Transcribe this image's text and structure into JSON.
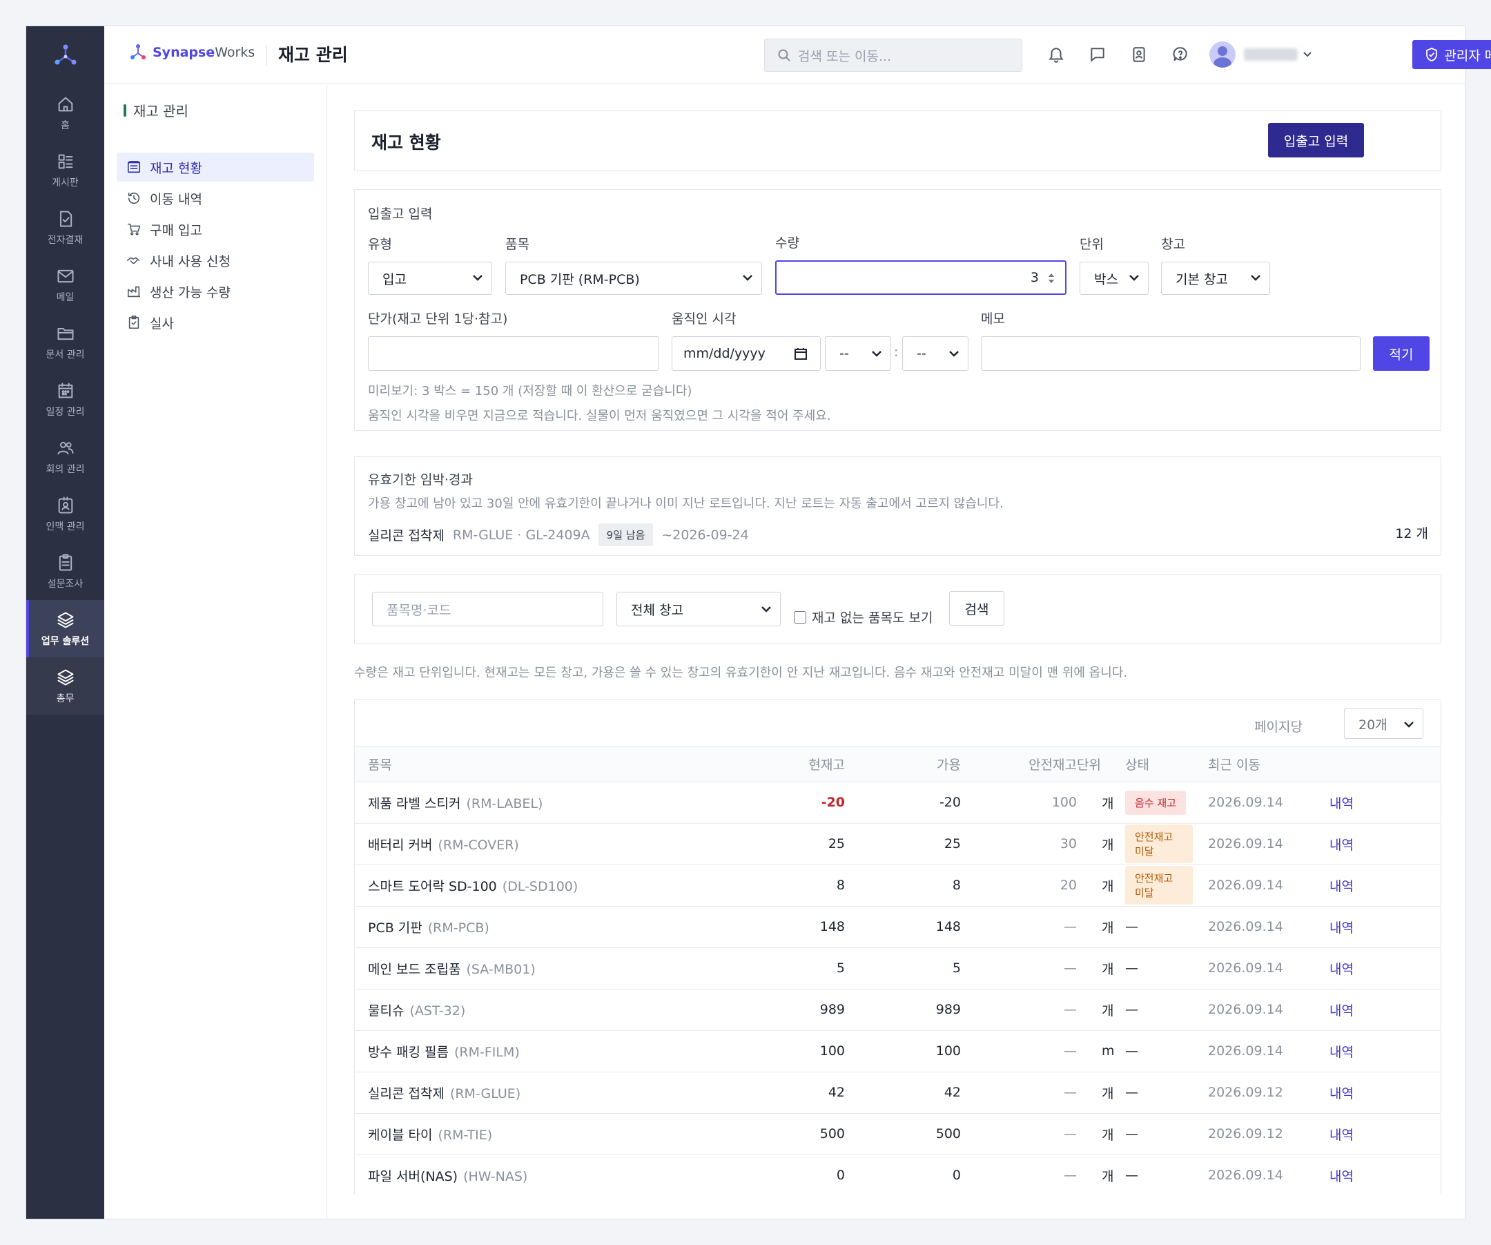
{
  "app": {
    "brand_bold": "Synapse",
    "brand_rest": "Works",
    "page_title": "재고 관리",
    "search_placeholder": "검색 또는 이동...",
    "admin_menu": "관리자 메뉴"
  },
  "rail": [
    {
      "label": "홈",
      "icon": "home-icon"
    },
    {
      "label": "게시판",
      "icon": "board-icon"
    },
    {
      "label": "전자결재",
      "icon": "approval-icon"
    },
    {
      "label": "메일",
      "icon": "mail-icon"
    },
    {
      "label": "문서 관리",
      "icon": "folder-icon"
    },
    {
      "label": "일정 관리",
      "icon": "calendar-icon"
    },
    {
      "label": "회의 관리",
      "icon": "people-icon"
    },
    {
      "label": "인맥 관리",
      "icon": "contact-icon"
    },
    {
      "label": "설문조사",
      "icon": "clipboard-icon"
    },
    {
      "label": "업무 솔루션",
      "icon": "layers-icon"
    },
    {
      "label": "총무",
      "icon": "layers-icon"
    }
  ],
  "subnav": {
    "title": "재고 관리",
    "items": [
      {
        "label": "재고 현황",
        "icon": "inventory-icon"
      },
      {
        "label": "이동 내역",
        "icon": "history-icon"
      },
      {
        "label": "구매 입고",
        "icon": "cart-icon"
      },
      {
        "label": "사내 사용 신청",
        "icon": "handshake-icon"
      },
      {
        "label": "생산 가능 수량",
        "icon": "factory-icon"
      },
      {
        "label": "실사",
        "icon": "checklist-icon"
      }
    ]
  },
  "main": {
    "title": "재고 현황",
    "entry_button": "입출고 입력"
  },
  "entry_form": {
    "title": "입출고 입력",
    "type_label": "유형",
    "type_value": "입고",
    "item_label": "품목",
    "item_value": "PCB 기판 (RM-PCB)",
    "qty_label": "수량",
    "qty_value": "3",
    "unit_label": "단위",
    "unit_value": "박스",
    "warehouse_label": "창고",
    "warehouse_value": "기본 창고",
    "price_label": "단가(재고 단위 1당·참고)",
    "time_label": "움직인 시각",
    "date_placeholder": "mm/dd/yyyy",
    "hour_value": "--",
    "minute_value": "--",
    "colon": ":",
    "memo_label": "메모",
    "submit": "적기",
    "preview_note": "미리보기: 3 박스 = 150 개 (저장할 때 이 환산으로 굳습니다)",
    "time_note": "움직인 시각을 비우면 지금으로 적습니다. 실물이 먼저 움직였으면 그 시각을 적어 주세요."
  },
  "expiry": {
    "title": "유효기한 임박·경과",
    "desc": "가용 창고에 남아 있고 30일 안에 유효기한이 끝나거나 이미 지난 로트입니다. 지난 로트는 자동 출고에서 고르지 않습니다.",
    "item_name": "실리콘 접착제",
    "lot": "RM-GLUE · GL-2409A",
    "days_left": "9일 남음",
    "expires": "~2026-09-24",
    "qty": "12 개"
  },
  "filter": {
    "search_placeholder": "품목명·코드",
    "warehouse_value": "전체 창고",
    "show_empty_label": "재고 없는 품목도 보기",
    "search_button": "검색"
  },
  "table_note": "수량은 재고 단위입니다. 현재고는 모든 창고, 가용은 쓸 수 있는 창고의 유효기한이 안 지난 재고입니다. 음수 재고와 안전재고 미달이 맨 위에 옵니다.",
  "table": {
    "per_page_label": "페이지당",
    "per_page_value": "20개",
    "headers": [
      "품목",
      "현재고",
      "가용",
      "안전재고",
      "단위",
      "상태",
      "최근 이동",
      ""
    ],
    "rows": [
      {
        "name": "제품 라벨 스티커",
        "code": "(RM-LABEL)",
        "stock": "-20",
        "avail": "-20",
        "safety": "100",
        "unit": "개",
        "status": "음수 재고",
        "status_type": "neg",
        "last": "2026.09.14",
        "link": "내역"
      },
      {
        "name": "배터리 커버",
        "code": "(RM-COVER)",
        "stock": "25",
        "avail": "25",
        "safety": "30",
        "unit": "개",
        "status": "안전재고 미달",
        "status_type": "low",
        "last": "2026.09.14",
        "link": "내역"
      },
      {
        "name": "스마트 도어락 SD-100",
        "code": "(DL-SD100)",
        "stock": "8",
        "avail": "8",
        "safety": "20",
        "unit": "개",
        "status": "안전재고 미달",
        "status_type": "low",
        "last": "2026.09.14",
        "link": "내역"
      },
      {
        "name": "PCB 기판",
        "code": "(RM-PCB)",
        "stock": "148",
        "avail": "148",
        "safety": "—",
        "unit": "개",
        "status": "—",
        "status_type": "none",
        "last": "2026.09.14",
        "link": "내역"
      },
      {
        "name": "메인 보드 조립품",
        "code": "(SA-MB01)",
        "stock": "5",
        "avail": "5",
        "safety": "—",
        "unit": "개",
        "status": "—",
        "status_type": "none",
        "last": "2026.09.14",
        "link": "내역"
      },
      {
        "name": "물티슈",
        "code": "(AST-32)",
        "stock": "989",
        "avail": "989",
        "safety": "—",
        "unit": "개",
        "status": "—",
        "status_type": "none",
        "last": "2026.09.14",
        "link": "내역"
      },
      {
        "name": "방수 패킹 필름",
        "code": "(RM-FILM)",
        "stock": "100",
        "avail": "100",
        "safety": "—",
        "unit": "m",
        "status": "—",
        "status_type": "none",
        "last": "2026.09.14",
        "link": "내역"
      },
      {
        "name": "실리콘 접착제",
        "code": "(RM-GLUE)",
        "stock": "42",
        "avail": "42",
        "safety": "—",
        "unit": "개",
        "status": "—",
        "status_type": "none",
        "last": "2026.09.12",
        "link": "내역"
      },
      {
        "name": "케이블 타이",
        "code": "(RM-TIE)",
        "stock": "500",
        "avail": "500",
        "safety": "—",
        "unit": "개",
        "status": "—",
        "status_type": "none",
        "last": "2026.09.12",
        "link": "내역"
      },
      {
        "name": "파일 서버(NAS)",
        "code": "(HW-NAS)",
        "stock": "0",
        "avail": "0",
        "safety": "—",
        "unit": "개",
        "status": "—",
        "status_type": "none",
        "last": "2026.09.14",
        "link": "내역"
      }
    ]
  },
  "colors": {
    "accent": "#4f46e5",
    "rail_bg": "#2b3142",
    "negative": "#c0262d",
    "warning": "#b45a05"
  }
}
